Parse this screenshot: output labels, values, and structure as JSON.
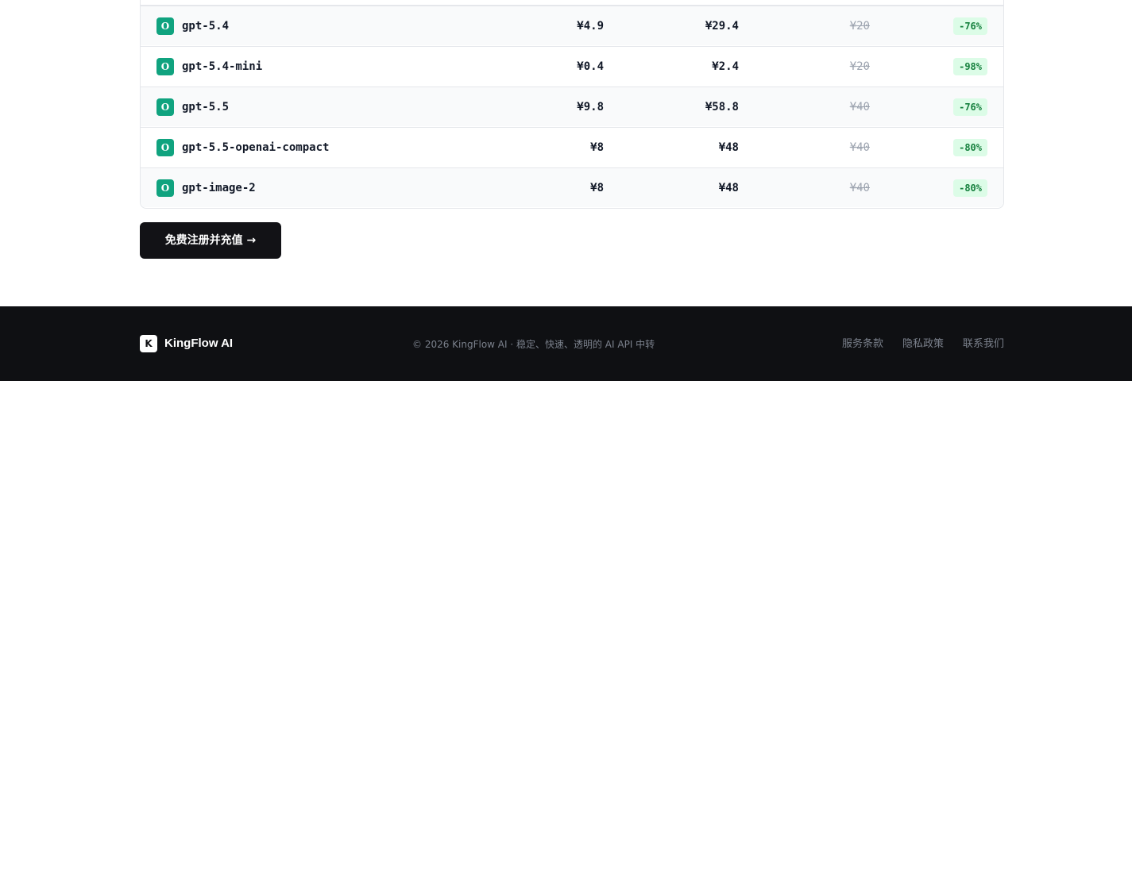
{
  "pricing_table": {
    "rows": [
      {
        "provider_icon": "O",
        "model": "gpt-5.4",
        "input_price": "¥4.9",
        "output_price": "¥29.4",
        "original_price": "¥20",
        "discount": "-76%"
      },
      {
        "provider_icon": "O",
        "model": "gpt-5.4-mini",
        "input_price": "¥0.4",
        "output_price": "¥2.4",
        "original_price": "¥20",
        "discount": "-98%"
      },
      {
        "provider_icon": "O",
        "model": "gpt-5.5",
        "input_price": "¥9.8",
        "output_price": "¥58.8",
        "original_price": "¥40",
        "discount": "-76%"
      },
      {
        "provider_icon": "O",
        "model": "gpt-5.5-openai-compact",
        "input_price": "¥8",
        "output_price": "¥48",
        "original_price": "¥40",
        "discount": "-80%"
      },
      {
        "provider_icon": "O",
        "model": "gpt-image-2",
        "input_price": "¥8",
        "output_price": "¥48",
        "original_price": "¥40",
        "discount": "-80%"
      }
    ]
  },
  "cta": {
    "label": "免费注册并充值 →"
  },
  "footer": {
    "logo_mark": "K",
    "brand": "KingFlow AI",
    "copyright": "© 2026 KingFlow AI · 稳定、快速、透明的 AI API 中转",
    "links": [
      "服务条款",
      "隐私政策",
      "联系我们"
    ]
  },
  "colors": {
    "provider_badge": "#10a37f",
    "discount_bg": "#dcfce7",
    "discount_text": "#15803d",
    "cta_bg": "#121216",
    "footer_bg": "#0f1013"
  },
  "icons": {
    "provider": "openai-icon",
    "logo": "kingflow-logo-icon"
  }
}
